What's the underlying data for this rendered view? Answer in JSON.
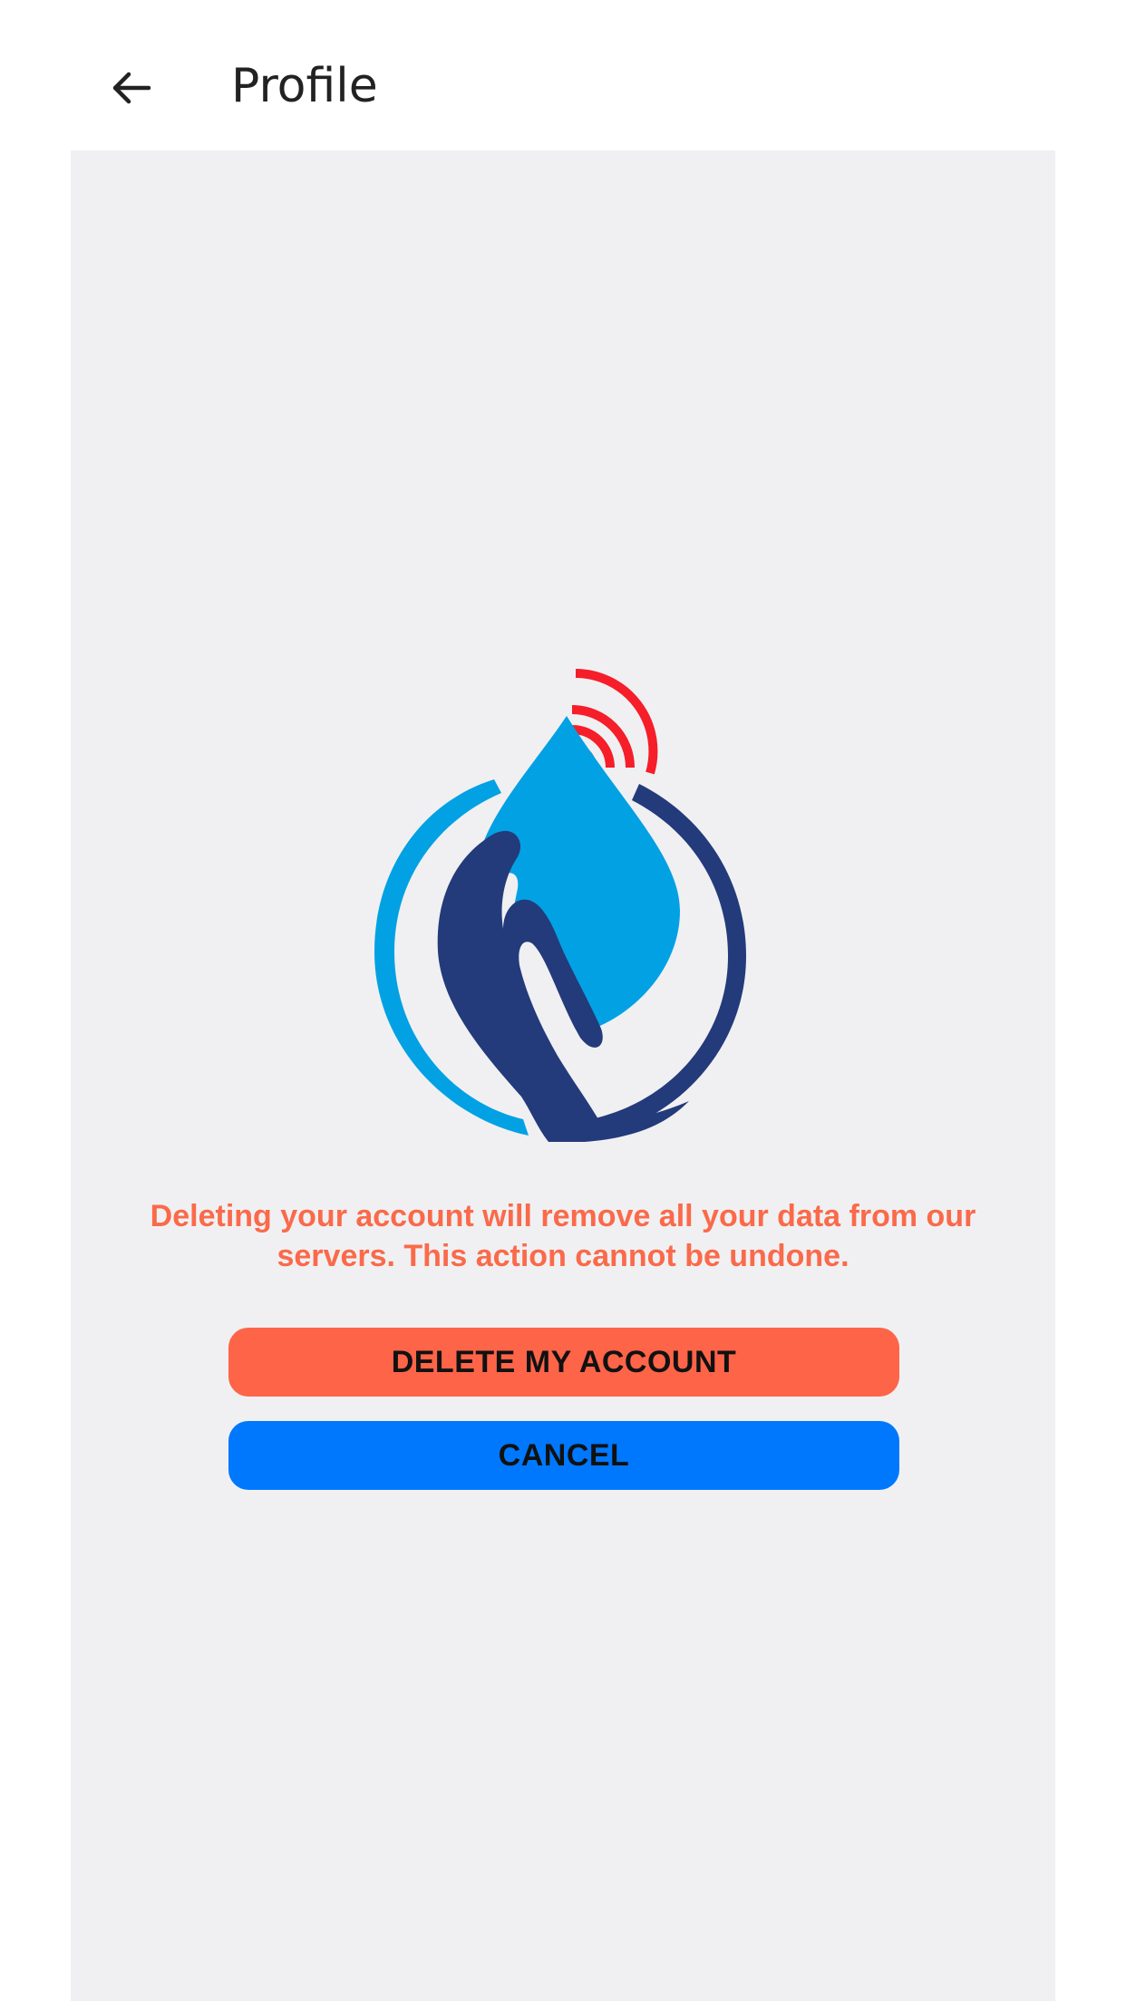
{
  "header": {
    "back_icon": "arrow-left-icon",
    "title": "Profile"
  },
  "logo": {
    "name": "water-drop-hand-signal-logo",
    "colors": {
      "drop": "#02a1e4",
      "hand": "#233a7b",
      "ring_light": "#02a1e4",
      "ring_dark": "#233a7b",
      "signal": "#f51e29"
    }
  },
  "dialog": {
    "warning": "Deleting your account will remove all your data from our servers. This action cannot be undone.",
    "warning_color": "#fa6a4a",
    "delete_label": "DELETE MY ACCOUNT",
    "delete_color": "#fe6448",
    "cancel_label": "CANCEL",
    "cancel_color": "#0078fe"
  }
}
